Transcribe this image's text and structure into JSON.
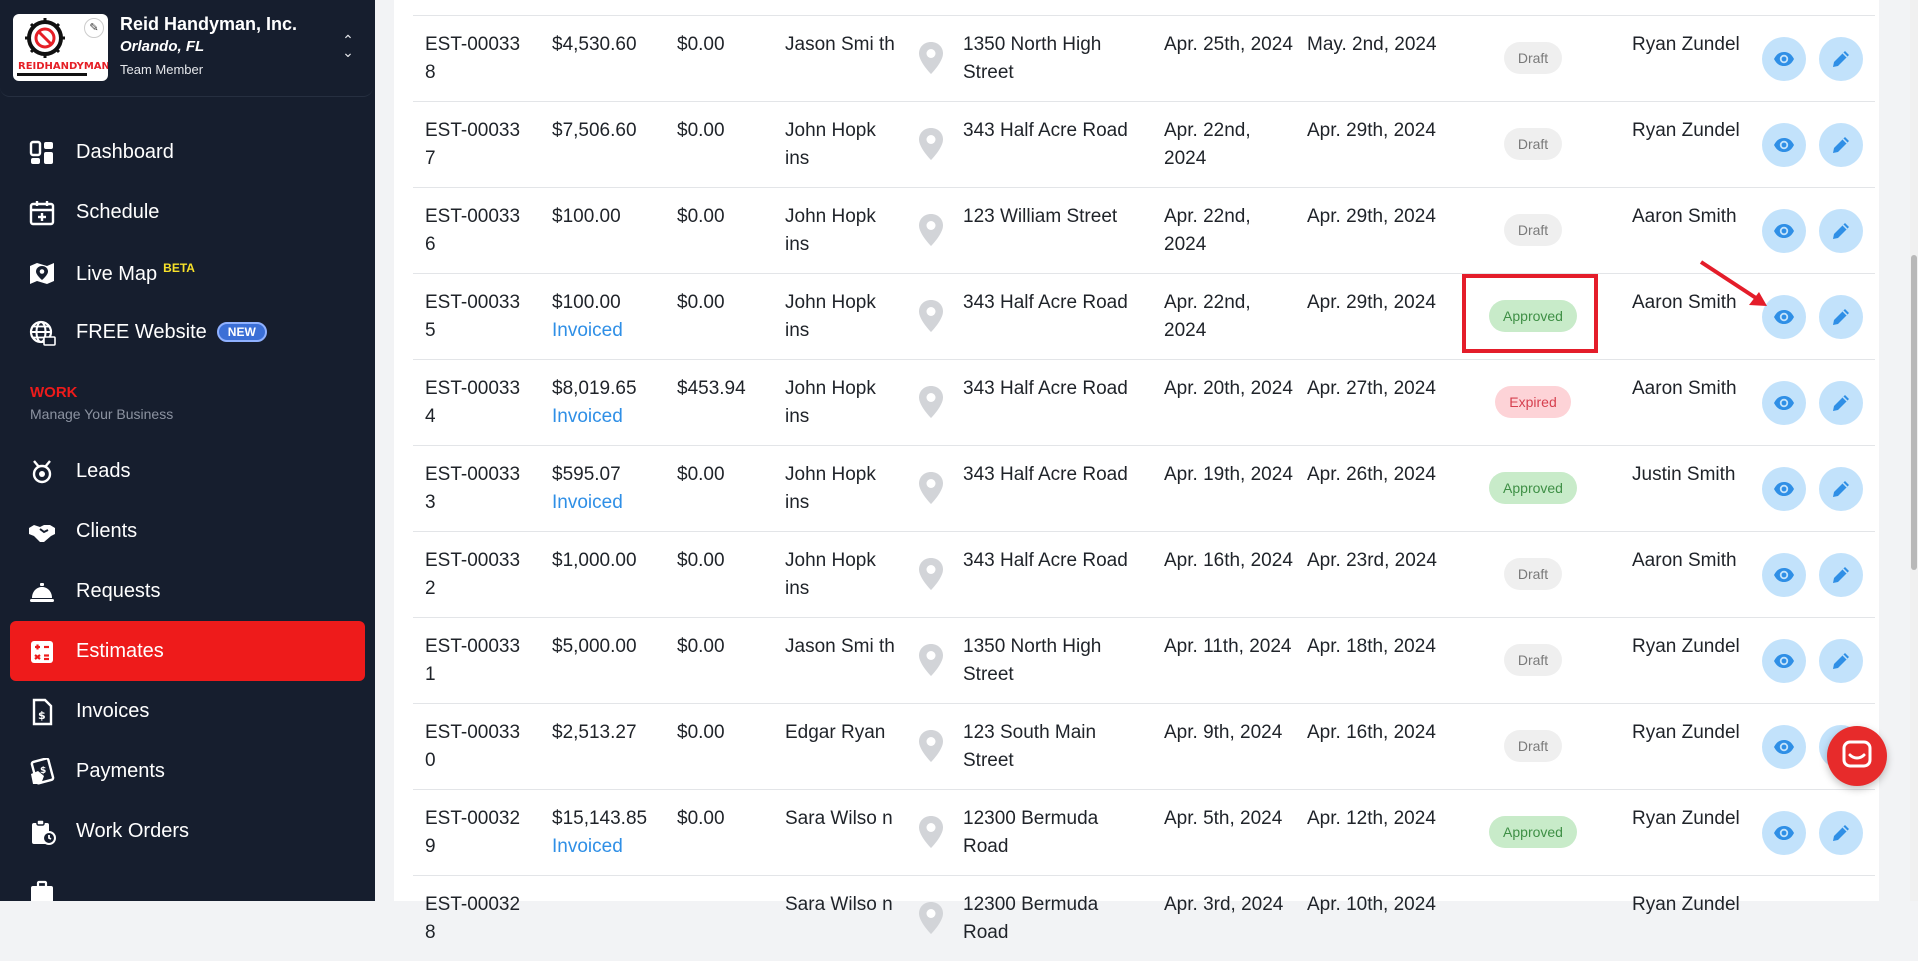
{
  "company": {
    "name": "Reid Handyman, Inc.",
    "location": "Orlando, FL",
    "role": "Team Member",
    "logo_text": "REIDHANDYMAN"
  },
  "nav": {
    "dashboard": "Dashboard",
    "schedule": "Schedule",
    "live_map": "Live Map",
    "live_map_badge": "BETA",
    "free_website": "FREE Website",
    "free_website_badge": "NEW",
    "section_title": "WORK",
    "section_subtitle": "Manage Your Business",
    "leads": "Leads",
    "clients": "Clients",
    "requests": "Requests",
    "estimates": "Estimates",
    "invoices": "Invoices",
    "payments": "Payments",
    "work_orders": "Work Orders"
  },
  "colors": {
    "sidebar_bg": "#161e2e",
    "active_nav": "#ee1b1b",
    "link_blue": "#2f8fe6",
    "action_button": "#c2e2fb"
  },
  "rows": [
    {
      "number": "EST-00033 8",
      "total": "$4,530.60",
      "invoiced": "",
      "paid": "$0.00",
      "client": "Jason Smi th",
      "address": "1350 North High Street",
      "date_created": "Apr. 25th, 2024",
      "date_valid": "May. 2nd, 2024",
      "status": "Draft",
      "status_type": "draft",
      "assignee": "Ryan Zundel"
    },
    {
      "number": "EST-00033 7",
      "total": "$7,506.60",
      "invoiced": "",
      "paid": "$0.00",
      "client": "John Hopk ins",
      "address": "343 Half Acre Road",
      "date_created": "Apr. 22nd, 2024",
      "date_valid": "Apr. 29th, 2024",
      "status": "Draft",
      "status_type": "draft",
      "assignee": "Ryan Zundel"
    },
    {
      "number": "EST-00033 6",
      "total": "$100.00",
      "invoiced": "",
      "paid": "$0.00",
      "client": "John Hopk ins",
      "address": "123 William Street",
      "date_created": "Apr. 22nd, 2024",
      "date_valid": "Apr. 29th, 2024",
      "status": "Draft",
      "status_type": "draft",
      "assignee": "Aaron Smith"
    },
    {
      "number": "EST-00033 5",
      "total": "$100.00",
      "invoiced": "Invoiced",
      "paid": "$0.00",
      "client": "John Hopk ins",
      "address": "343 Half Acre Road",
      "date_created": "Apr. 22nd, 2024",
      "date_valid": "Apr. 29th, 2024",
      "status": "Approved",
      "status_type": "approved",
      "assignee": "Aaron Smith"
    },
    {
      "number": "EST-00033 4",
      "total": "$8,019.65",
      "invoiced": "Invoiced",
      "paid": "$453.94",
      "client": "John Hopk ins",
      "address": "343 Half Acre Road",
      "date_created": "Apr. 20th, 2024",
      "date_valid": "Apr. 27th, 2024",
      "status": "Expired",
      "status_type": "expired",
      "assignee": "Aaron Smith"
    },
    {
      "number": "EST-00033 3",
      "total": "$595.07",
      "invoiced": "Invoiced",
      "paid": "$0.00",
      "client": "John Hopk ins",
      "address": "343 Half Acre Road",
      "date_created": "Apr. 19th, 2024",
      "date_valid": "Apr. 26th, 2024",
      "status": "Approved",
      "status_type": "approved",
      "assignee": "Justin Smith"
    },
    {
      "number": "EST-00033 2",
      "total": "$1,000.00",
      "invoiced": "",
      "paid": "$0.00",
      "client": "John Hopk ins",
      "address": "343 Half Acre Road",
      "date_created": "Apr. 16th, 2024",
      "date_valid": "Apr. 23rd, 2024",
      "status": "Draft",
      "status_type": "draft",
      "assignee": "Aaron Smith"
    },
    {
      "number": "EST-00033 1",
      "total": "$5,000.00",
      "invoiced": "",
      "paid": "$0.00",
      "client": "Jason Smi th",
      "address": "1350 North High Street",
      "date_created": "Apr. 11th, 2024",
      "date_valid": "Apr. 18th, 2024",
      "status": "Draft",
      "status_type": "draft",
      "assignee": "Ryan Zundel"
    },
    {
      "number": "EST-00033 0",
      "total": "$2,513.27",
      "invoiced": "",
      "paid": "$0.00",
      "client": "Edgar Ryan",
      "address": "123 South Main Street",
      "date_created": "Apr. 9th, 2024",
      "date_valid": "Apr. 16th, 2024",
      "status": "Draft",
      "status_type": "draft",
      "assignee": "Ryan Zundel"
    },
    {
      "number": "EST-00032 9",
      "total": "$15,143.85",
      "invoiced": "Invoiced",
      "paid": "$0.00",
      "client": "Sara Wilso n",
      "address": "12300 Bermuda Road",
      "date_created": "Apr. 5th, 2024",
      "date_valid": "Apr. 12th, 2024",
      "status": "Approved",
      "status_type": "approved",
      "assignee": "Ryan Zundel"
    },
    {
      "number": "EST-00032 8",
      "total": "",
      "invoiced": "",
      "paid": "",
      "client": "Sara Wilso n",
      "address": "12300 Bermuda Road",
      "date_created": "Apr. 3rd, 2024",
      "date_valid": "Apr. 10th, 2024",
      "status": "",
      "status_type": "",
      "assignee": "Ryan Zundel"
    }
  ]
}
